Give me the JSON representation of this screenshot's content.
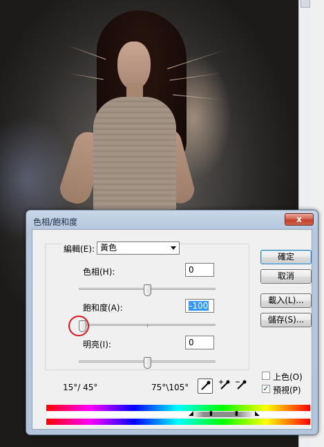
{
  "dialog": {
    "title": "色相/飽和度",
    "close_label": "x"
  },
  "edit": {
    "label": "編輯(E):",
    "selected_option": "黃色"
  },
  "controls": {
    "hue": {
      "label": "色相(H):",
      "value": "0",
      "slider_fraction": 0.5
    },
    "saturation": {
      "label": "飽和度(A):",
      "value": "-100",
      "slider_fraction": 0.0
    },
    "lightness": {
      "label": "明亮(I):",
      "value": "0",
      "slider_fraction": 0.5
    }
  },
  "buttons": {
    "ok": "確定",
    "cancel": "取消",
    "load": "載入(L)...",
    "save": "儲存(S)..."
  },
  "options": {
    "colorize": {
      "label": "上色(O)",
      "checked": false
    },
    "preview": {
      "label": "預視(P)",
      "checked": true,
      "mark": "✓"
    }
  },
  "range": {
    "left": "15°/ 45°",
    "right": "75°\\105°"
  },
  "icons": [
    "eyedropper-icon",
    "eyedropper-plus-icon",
    "eyedropper-minus-icon"
  ],
  "colors": {
    "title_bar": "#b6c8de",
    "close_button": "#c0402b",
    "selection": "#3399ff",
    "highlight_circle": "#e0141e"
  }
}
